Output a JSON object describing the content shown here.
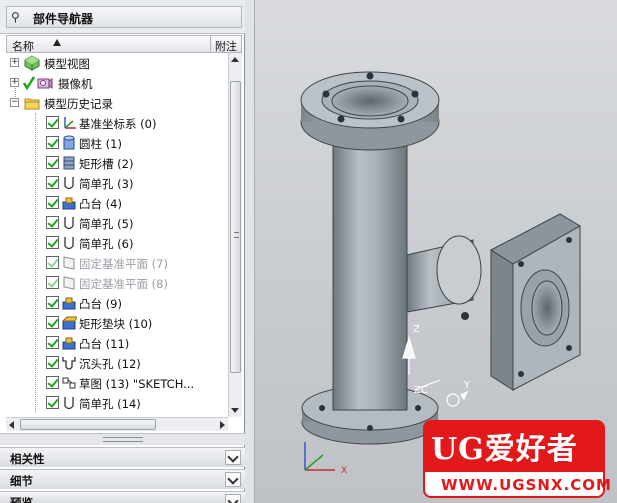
{
  "navigator": {
    "title": "部件导航器",
    "columns": {
      "name": "名称",
      "notes": "附注"
    },
    "tree": [
      {
        "label": "模型视图",
        "icon": "model-views-icon"
      },
      {
        "label": "摄像机",
        "icon": "camera-icon"
      },
      {
        "label": "模型历史记录",
        "icon": "folder-icon"
      },
      {
        "label": "基准坐标系 (0)",
        "icon": "datum-csys-icon"
      },
      {
        "label": "圆柱 (1)",
        "icon": "cylinder-icon"
      },
      {
        "label": "矩形槽 (2)",
        "icon": "rectangular-slot-icon"
      },
      {
        "label": "简单孔 (3)",
        "icon": "simple-hole-icon"
      },
      {
        "label": "凸台 (4)",
        "icon": "boss-icon"
      },
      {
        "label": "简单孔 (5)",
        "icon": "simple-hole-icon"
      },
      {
        "label": "简单孔 (6)",
        "icon": "simple-hole-icon"
      },
      {
        "label": "固定基准平面 (7)",
        "icon": "datum-plane-icon"
      },
      {
        "label": "固定基准平面 (8)",
        "icon": "datum-plane-icon"
      },
      {
        "label": "凸台 (9)",
        "icon": "boss-icon"
      },
      {
        "label": "矩形垫块 (10)",
        "icon": "rectangular-pad-icon"
      },
      {
        "label": "凸台 (11)",
        "icon": "boss-icon"
      },
      {
        "label": "沉头孔 (12)",
        "icon": "counterbore-hole-icon"
      },
      {
        "label": "草图 (13) \"SKETCH...",
        "icon": "sketch-icon"
      },
      {
        "label": "简单孔 (14)",
        "icon": "simple-hole-icon"
      }
    ]
  },
  "sections": {
    "dependencies": "相关性",
    "details": "细节",
    "preview": "预览"
  },
  "viewport": {
    "axis_labels": {
      "z": "Z",
      "zc": "ZC",
      "y": "Y",
      "x": "X"
    }
  },
  "watermark": {
    "brand": "UG爱好者",
    "url": "WWW.UGSNX.COM"
  },
  "colors": {
    "accent_check": "#1aa61a",
    "model_body": "#9ea7ad",
    "watermark_red": "#e3181a"
  }
}
